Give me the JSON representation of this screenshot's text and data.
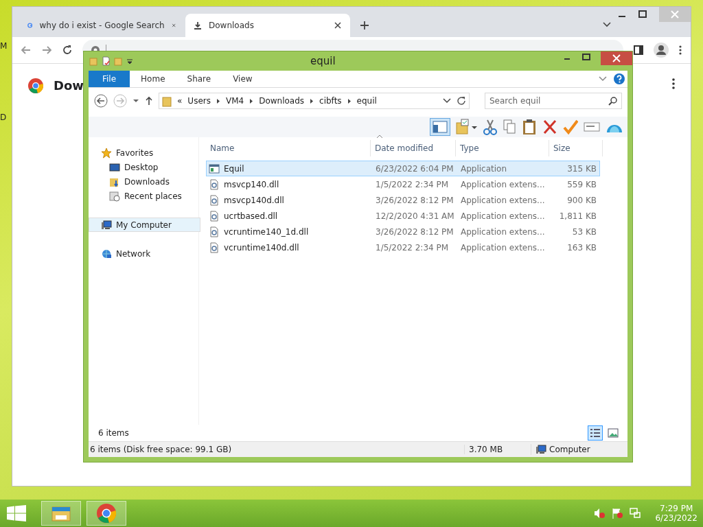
{
  "desktop_labels": [
    "M",
    "D"
  ],
  "browser": {
    "tabs": [
      {
        "title": "why do i exist - Google Search",
        "kind": "google",
        "selected": false
      },
      {
        "title": "Downloads",
        "kind": "download",
        "selected": true
      }
    ],
    "page_title": "Dow"
  },
  "explorer": {
    "title": "equil",
    "ribbon_tabs": [
      {
        "label": "File",
        "selected": true
      },
      {
        "label": "Home",
        "selected": false
      },
      {
        "label": "Share",
        "selected": false
      },
      {
        "label": "View",
        "selected": false
      }
    ],
    "breadcrumb_prefix": "«",
    "path": [
      "Users",
      "VM4",
      "Downloads",
      "cibfts",
      "equil"
    ],
    "search": {
      "placeholder": "Search equil"
    },
    "nav": [
      {
        "label": "Favorites",
        "kind": "star",
        "selected": false,
        "children": [
          {
            "label": "Desktop",
            "kind": "desktop",
            "selected": false
          },
          {
            "label": "Downloads",
            "kind": "downloads",
            "selected": false
          },
          {
            "label": "Recent places",
            "kind": "recent",
            "selected": false
          }
        ]
      },
      {
        "label": "My Computer",
        "kind": "computer",
        "selected": true
      },
      {
        "label": "Network",
        "kind": "network",
        "selected": false
      }
    ],
    "columns": [
      "Name",
      "Date modified",
      "Type",
      "Size"
    ],
    "rows": [
      {
        "kind": "app",
        "name": "Equil",
        "date": "6/23/2022 6:04 PM",
        "type": "Application",
        "size": "315 KB",
        "selected": true
      },
      {
        "kind": "dll",
        "name": "msvcp140.dll",
        "date": "1/5/2022 2:34 PM",
        "type": "Application extens...",
        "size": "559 KB",
        "selected": false
      },
      {
        "kind": "dll",
        "name": "msvcp140d.dll",
        "date": "3/26/2022 8:12 PM",
        "type": "Application extens...",
        "size": "900 KB",
        "selected": false
      },
      {
        "kind": "dll",
        "name": "ucrtbased.dll",
        "date": "12/2/2020 4:31 AM",
        "type": "Application extens...",
        "size": "1,811 KB",
        "selected": false
      },
      {
        "kind": "dll",
        "name": "vcruntime140_1d.dll",
        "date": "3/26/2022 8:12 PM",
        "type": "Application extens...",
        "size": "53 KB",
        "selected": false
      },
      {
        "kind": "dll",
        "name": "vcruntime140d.dll",
        "date": "1/5/2022 2:34 PM",
        "type": "Application extens...",
        "size": "163 KB",
        "selected": false
      }
    ],
    "item_count": "6 items",
    "views": [
      {
        "kind": "details",
        "selected": true
      },
      {
        "kind": "large",
        "selected": false
      }
    ],
    "status": {
      "summary": "6 items (Disk free space: 99.1 GB)",
      "size": "3.70 MB",
      "location": "Computer"
    }
  },
  "taskbar": {
    "apps": [
      {
        "kind": "explorer"
      },
      {
        "kind": "chrome"
      }
    ],
    "time": "7:29 PM",
    "date": "6/23/2022"
  }
}
